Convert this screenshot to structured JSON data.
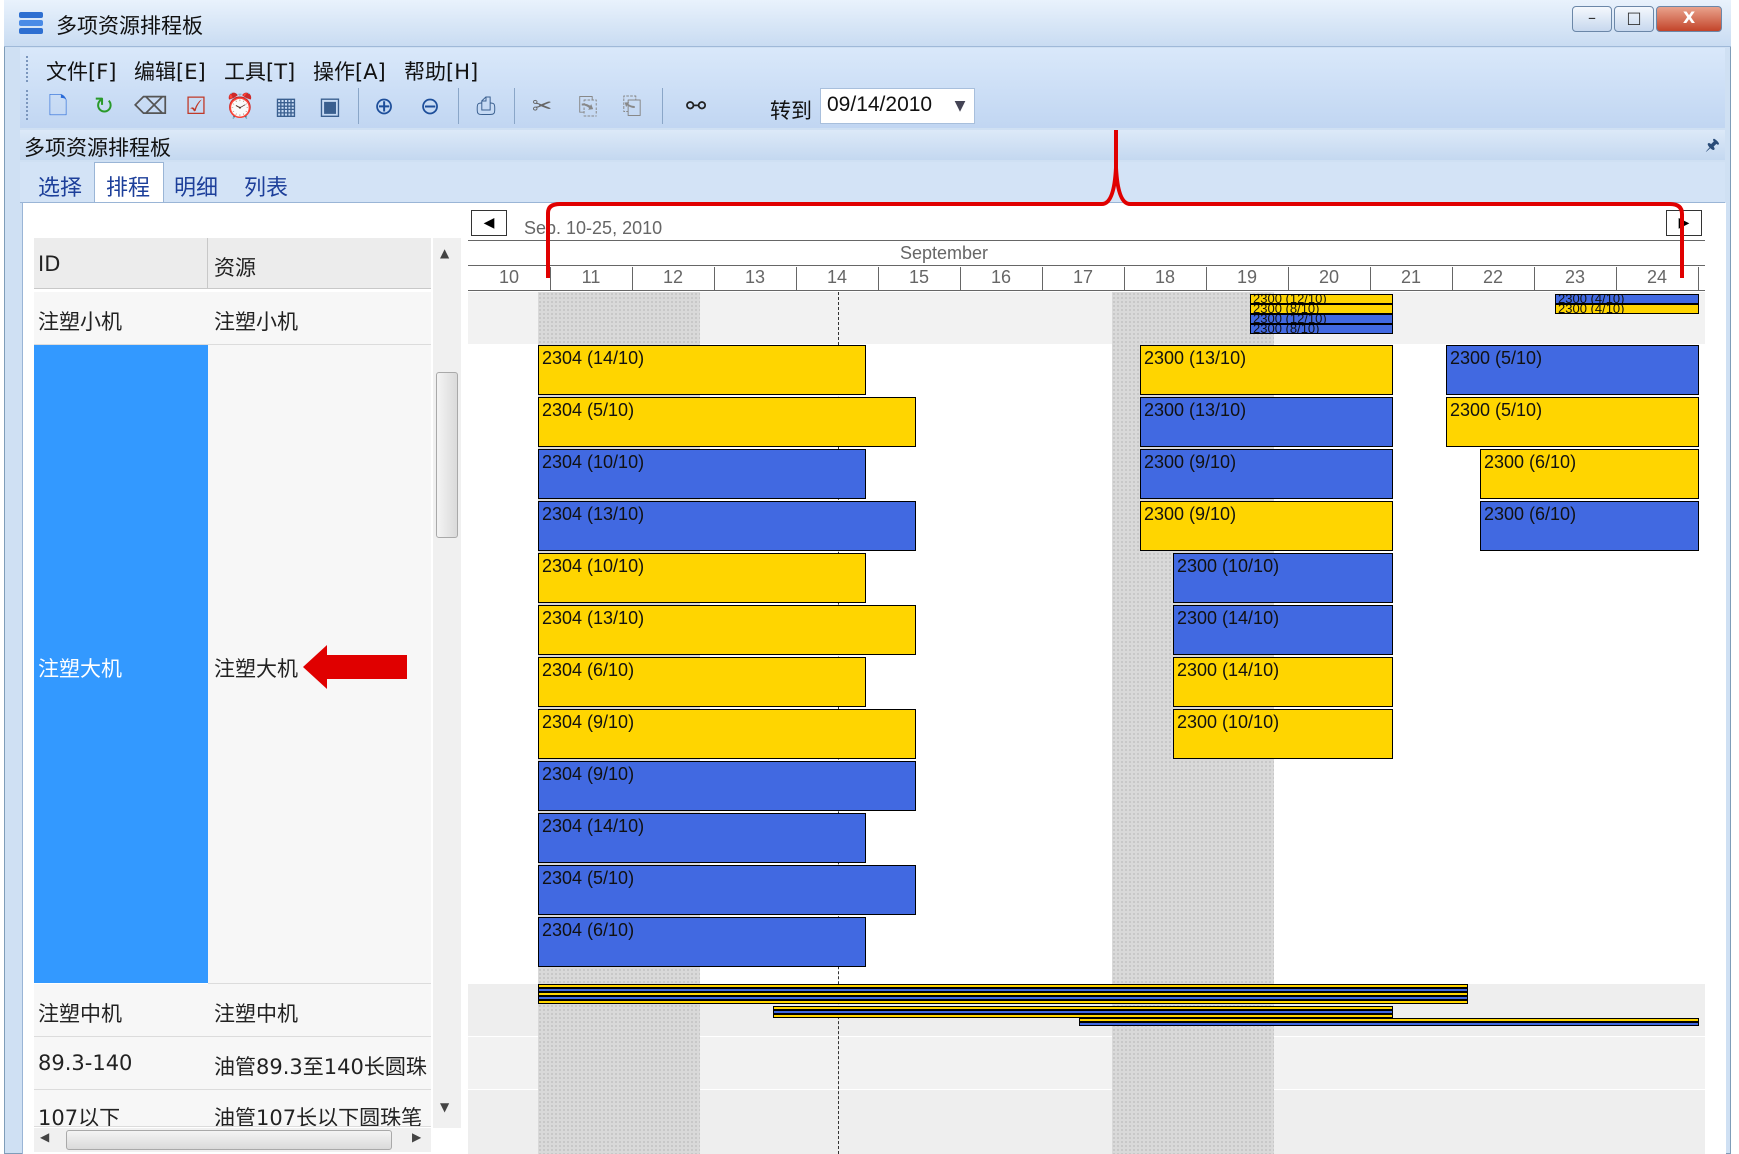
{
  "window": {
    "title": "多项资源排程板",
    "min": "–",
    "max": "□",
    "close": "X"
  },
  "menu": [
    "文件[F]",
    "编辑[E]",
    "工具[T]",
    "操作[A]",
    "帮助[H]"
  ],
  "toolbar": {
    "icons": [
      "new-icon",
      "refresh-icon",
      "eraser-icon",
      "checklist-icon",
      "alarm-icon",
      "calendar-icon",
      "image-icon",
      "zoom-in-icon",
      "zoom-out-icon",
      "print-icon",
      "cut-icon",
      "copy-icon",
      "paste-icon",
      "find-icon"
    ],
    "goto_label": "转到",
    "goto_value": "09/14/2010"
  },
  "panel": {
    "title": "多项资源排程板"
  },
  "tabs": [
    "选择",
    "排程",
    "明细",
    "列表"
  ],
  "active_tab": "排程",
  "grid": {
    "headers": {
      "id": "ID",
      "resource": "资源"
    },
    "rows": [
      {
        "id": "注塑小机",
        "resource": "注塑小机"
      },
      {
        "id": "注塑大机",
        "resource": "注塑大机"
      },
      {
        "id": "注塑中机",
        "resource": "注塑中机"
      },
      {
        "id": "89.3-140",
        "resource": "油管89.3至140长圆珠"
      },
      {
        "id": "107以下",
        "resource": "油管107长以下圆珠笔"
      }
    ]
  },
  "gantt": {
    "range_label": "Sep. 10-25, 2010",
    "month_label": "September",
    "days": [
      "10",
      "11",
      "12",
      "13",
      "14",
      "15",
      "16",
      "17",
      "18",
      "19",
      "20",
      "21",
      "22",
      "23",
      "24"
    ],
    "colors": {
      "yellow": "#ffd500",
      "blue": "#4169e1",
      "selected": "#3399ff"
    },
    "large_machine_bars": [
      {
        "label": "2304 (14/10)",
        "color": "yellow"
      },
      {
        "label": "2304 (5/10)",
        "color": "yellow"
      },
      {
        "label": "2304 (10/10)",
        "color": "blue"
      },
      {
        "label": "2304 (13/10)",
        "color": "blue"
      },
      {
        "label": "2304 (10/10)",
        "color": "yellow"
      },
      {
        "label": "2304 (13/10)",
        "color": "yellow"
      },
      {
        "label": "2304 (6/10)",
        "color": "yellow"
      },
      {
        "label": "2304 (9/10)",
        "color": "yellow"
      },
      {
        "label": "2304 (9/10)",
        "color": "blue"
      },
      {
        "label": "2304 (14/10)",
        "color": "blue"
      },
      {
        "label": "2304 (5/10)",
        "color": "blue"
      },
      {
        "label": "2304 (6/10)",
        "color": "blue"
      },
      {
        "label": "2300 (13/10)",
        "color": "yellow"
      },
      {
        "label": "2300 (13/10)",
        "color": "blue"
      },
      {
        "label": "2300 (9/10)",
        "color": "blue"
      },
      {
        "label": "2300 (9/10)",
        "color": "yellow"
      },
      {
        "label": "2300 (10/10)",
        "color": "blue"
      },
      {
        "label": "2300 (14/10)",
        "color": "blue"
      },
      {
        "label": "2300 (14/10)",
        "color": "yellow"
      },
      {
        "label": "2300 (10/10)",
        "color": "yellow"
      },
      {
        "label": "2300 (5/10)",
        "color": "blue"
      },
      {
        "label": "2300 (5/10)",
        "color": "yellow"
      },
      {
        "label": "2300 (6/10)",
        "color": "yellow"
      },
      {
        "label": "2300 (6/10)",
        "color": "blue"
      }
    ],
    "small_machine_bars": [
      {
        "label": "2300 (12/10)",
        "color": "yellow"
      },
      {
        "label": "2300 (8/10)",
        "color": "yellow"
      },
      {
        "label": "2300 (12/10)",
        "color": "blue"
      },
      {
        "label": "2300 (8/10)",
        "color": "blue"
      },
      {
        "label": "2300 (4/10)",
        "color": "blue"
      },
      {
        "label": "2300 (4/10)",
        "color": "yellow"
      }
    ]
  }
}
